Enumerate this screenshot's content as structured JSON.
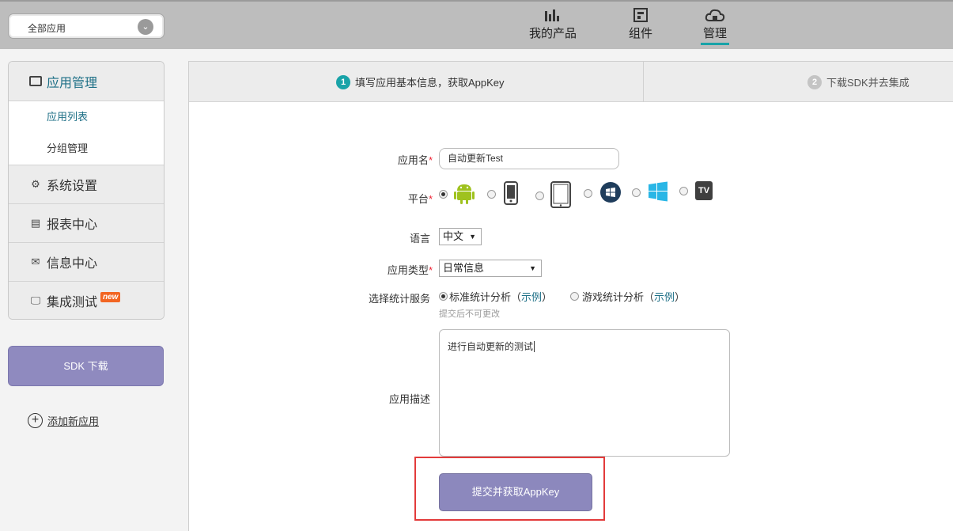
{
  "app_selector": {
    "value": "全部应用"
  },
  "top_nav": [
    {
      "label": "我的产品",
      "icon": "bar-chart-icon"
    },
    {
      "label": "组件",
      "icon": "component-icon"
    },
    {
      "label": "管理",
      "icon": "cloud-manage-icon",
      "active": true
    }
  ],
  "sidebar": {
    "header": "应用管理",
    "subitems": [
      {
        "label": "应用列表",
        "active": true
      },
      {
        "label": "分组管理"
      }
    ],
    "items": [
      {
        "label": "系统设置",
        "icon": "settings-icon"
      },
      {
        "label": "报表中心",
        "icon": "report-icon"
      },
      {
        "label": "信息中心",
        "icon": "mail-icon"
      },
      {
        "label": "集成测试",
        "icon": "monitor-icon",
        "badge": "new"
      }
    ]
  },
  "sdk_button": "SDK 下载",
  "add_app": "添加新应用",
  "steps": [
    {
      "num": "1",
      "label": "填写应用基本信息，获取AppKey",
      "active": true
    },
    {
      "num": "2",
      "label": "下载SDK并去集成",
      "active": false
    }
  ],
  "form": {
    "app_name_label": "应用名",
    "app_name_value": "自动更新Test",
    "platform_label": "平台",
    "platforms": [
      "android-icon",
      "phone-icon",
      "tablet-icon",
      "windows-phone-icon",
      "windows-icon",
      "tv-icon"
    ],
    "platform_tv_text": "TV",
    "selected_platform": "android-icon",
    "language_label": "语言",
    "language_value": "中文",
    "app_type_label": "应用类型",
    "app_type_value": "日常信息",
    "stat_service_label": "选择统计服务",
    "stat_options": [
      {
        "label": "标准统计分析",
        "example": "示例",
        "selected": true
      },
      {
        "label": "游戏统计分析",
        "example": "示例",
        "selected": false
      }
    ],
    "paren_open": "（",
    "paren_close": "）",
    "stat_hint": "提交后不可更改",
    "description_label": "应用描述",
    "description_value": "进行自动更新的测试",
    "submit_label": "提交并获取AppKey",
    "required_mark": "*"
  },
  "colors": {
    "accent": "#19a3a8",
    "link": "#1d6f86",
    "button": "#8c88bd",
    "highlight_border": "#e33b3b",
    "required": "#e22233"
  }
}
